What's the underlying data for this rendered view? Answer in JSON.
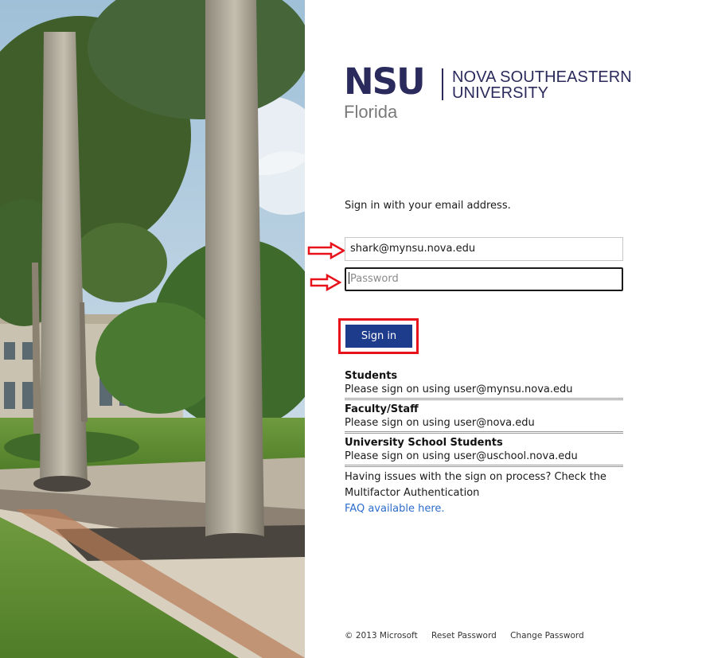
{
  "logo": {
    "abbreviation": "NSU",
    "name_line1": "NOVA SOUTHEASTERN",
    "name_line2": "UNIVERSITY",
    "location": "Florida"
  },
  "form": {
    "intro": "Sign in with your email address.",
    "email_value": "shark@mynsu.nova.edu",
    "password_placeholder": "Password",
    "signin_label": "Sign in"
  },
  "info": {
    "groups": [
      {
        "title": "Students",
        "text": "Please sign on using user@mynsu.nova.edu"
      },
      {
        "title": "Faculty/Staff",
        "text": "Please sign on using user@nova.edu"
      },
      {
        "title": "University School Students",
        "text": "Please sign on using user@uschool.nova.edu"
      }
    ],
    "issues_text": "Having issues with the sign on process? Check the Multifactor Authentication",
    "faq_link": "FAQ available here."
  },
  "footer": {
    "copyright": "© 2013 Microsoft",
    "reset_password": "Reset Password",
    "change_password": "Change Password"
  },
  "colors": {
    "brand_navy": "#2a2a5c",
    "button_blue": "#1e3c8c",
    "annotation_red": "#e8121b",
    "link_blue": "#2d6dcc"
  }
}
